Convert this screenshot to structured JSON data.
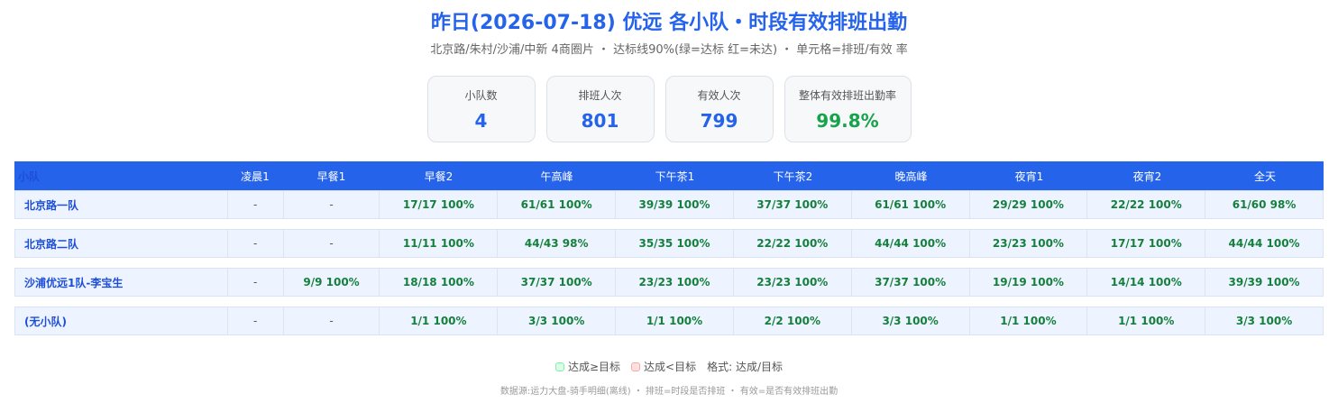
{
  "title": "昨日(2026-07-18) 优远 各小队・时段有效排班出勤",
  "subtitle": "北京路/朱村/沙浦/中新 4商圈片 ・ 达标线90%(绿=达标 红=未达) ・ 单元格=排班/有效 率",
  "kpis": [
    {
      "label": "小队数",
      "value": "4"
    },
    {
      "label": "排班人次",
      "value": "801"
    },
    {
      "label": "有效人次",
      "value": "799"
    },
    {
      "label": "整体有效排班出勤率",
      "value": "99.8%"
    }
  ],
  "table": {
    "headers": [
      "小队",
      "凌晨1",
      "早餐1",
      "早餐2",
      "午高峰",
      "下午茶1",
      "下午茶2",
      "晚高峰",
      "夜宵1",
      "夜宵2",
      "全天"
    ],
    "rows": [
      {
        "name": "北京路一队",
        "cells": [
          "-",
          "-",
          "17/17 100%",
          "61/61 100%",
          "39/39 100%",
          "37/37 100%",
          "61/61 100%",
          "29/29 100%",
          "22/22 100%",
          "61/60 98%"
        ]
      },
      {
        "name": "北京路二队",
        "cells": [
          "-",
          "-",
          "11/11 100%",
          "44/43 98%",
          "35/35 100%",
          "22/22 100%",
          "44/44 100%",
          "23/23 100%",
          "17/17 100%",
          "44/44 100%"
        ]
      },
      {
        "name": "沙浦优远1队-李宝生",
        "cells": [
          "-",
          "9/9 100%",
          "18/18 100%",
          "37/37 100%",
          "23/23 100%",
          "23/23 100%",
          "37/37 100%",
          "19/19 100%",
          "14/14 100%",
          "39/39 100%"
        ]
      },
      {
        "name": "(无小队)",
        "cells": [
          "-",
          "-",
          "1/1 100%",
          "3/3 100%",
          "1/1 100%",
          "2/2 100%",
          "3/3 100%",
          "1/1 100%",
          "1/1 100%",
          "3/3 100%"
        ]
      }
    ]
  },
  "legend": {
    "pass": "达成≥目标",
    "fail": "达成<目标",
    "format": "格式: 达成/目标"
  },
  "colors": {
    "accent": "#2563eb",
    "pass": "#16a34a",
    "fail": "#dc2626"
  },
  "footnote": "数据源:运力大盘-骑手明细(离线) ・ 排班=时段是否排班 ・ 有效=是否有效排班出勤"
}
